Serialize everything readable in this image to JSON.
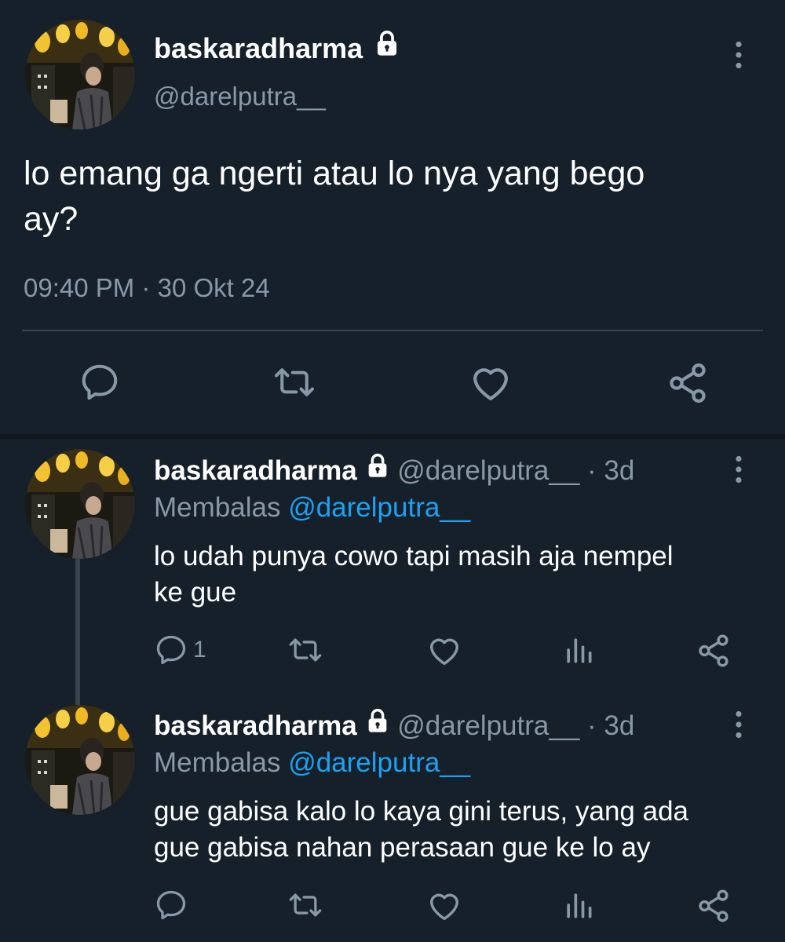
{
  "main_tweet": {
    "display_name": "baskaradharma",
    "handle": "@darelputra__",
    "text_line1": "lo emang ga ngerti atau lo nya yang bego",
    "text_line2": "ay?",
    "time": "09:40 PM",
    "separator": "·",
    "date": "30 Okt 24",
    "actions": [
      "reply",
      "retweet",
      "like",
      "share"
    ]
  },
  "replies": [
    {
      "display_name": "baskaradharma",
      "handle": "@darelputra__",
      "age": "· 3d",
      "replying_label": "Membalas",
      "replying_to": "@darelputra__",
      "text_line1": "lo udah punya cowo tapi masih aja nempel",
      "text_line2": "ke gue",
      "reply_count": "1"
    },
    {
      "display_name": "baskaradharma",
      "handle": "@darelputra__",
      "age": "· 3d",
      "replying_label": "Membalas",
      "replying_to": "@darelputra__",
      "text_line1": "gue gabisa kalo lo kaya gini terus, yang ada",
      "text_line2": "gue gabisa nahan perasaan gue ke lo ay",
      "reply_count": ""
    }
  ],
  "colors": {
    "background": "#15202b",
    "text": "#ffffff",
    "muted": "#8899a6",
    "link": "#1da1f2",
    "divider": "#38444d"
  },
  "icons": [
    "lock-icon",
    "more-vertical-icon",
    "reply-icon",
    "retweet-icon",
    "like-icon",
    "share-icon",
    "analytics-icon"
  ]
}
